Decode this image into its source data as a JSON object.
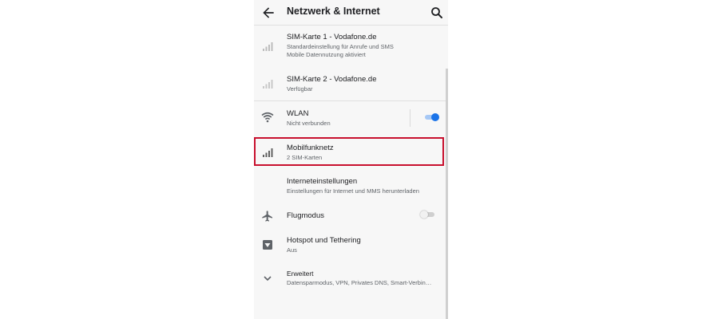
{
  "header": {
    "title": "Netzwerk & Internet",
    "back_icon": "arrow-back-icon",
    "search_icon": "search-icon"
  },
  "items": [
    {
      "title": "SIM-Karte 1 - Vodafone.de",
      "subtitle": "Standardeinstellung für Anrufe und SMS",
      "subtitle2": "Mobile Datennutzung aktiviert",
      "icon": "signal-icon"
    },
    {
      "title": "SIM-Karte 2 - Vodafone.de",
      "subtitle": "Verfügbar",
      "icon": "signal-icon"
    },
    {
      "title": "WLAN",
      "subtitle": "Nicht verbunden",
      "icon": "wifi-icon",
      "toggle_on": true
    },
    {
      "title": "Mobilfunknetz",
      "subtitle": "2 SIM-Karten",
      "icon": "signal-icon"
    },
    {
      "title": "Interneteinstellungen",
      "subtitle": "Einstellungen für Internet und MMS herunterladen"
    },
    {
      "title": "Flugmodus",
      "icon": "airplane-icon",
      "toggle_on": false
    },
    {
      "title": "Hotspot und Tethering",
      "subtitle": "Aus",
      "icon": "hotspot-icon"
    },
    {
      "title": "Erweitert",
      "subtitle": "Datensparmodus, VPN, Privates DNS, Smart-Verbin…",
      "icon": "chevron-down-icon"
    }
  ],
  "colors": {
    "accent": "#1a73e8",
    "highlight": "#c8102e",
    "background": "#f7f7f7"
  }
}
